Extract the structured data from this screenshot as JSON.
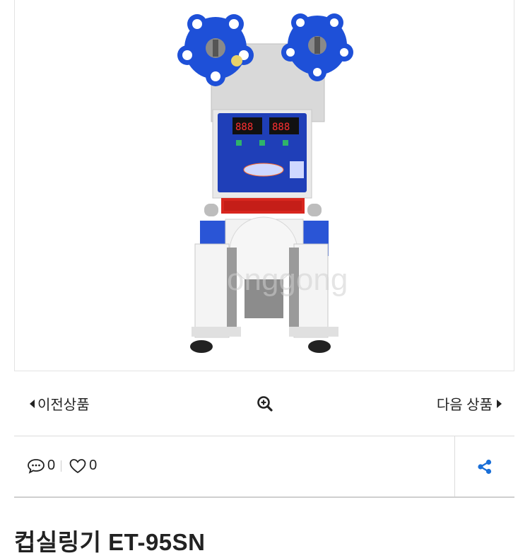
{
  "product_image": {
    "alt": "컵실링기 ET-95SN",
    "watermark": "onggong"
  },
  "navigation": {
    "prev_label": "이전상품",
    "next_label": "다음 상품"
  },
  "social": {
    "comment_count": "0",
    "like_count": "0"
  },
  "product": {
    "title": "컵실링기 ET-95SN"
  },
  "colors": {
    "accent": "#1a6fd8",
    "machine_blue": "#1f4fd0"
  }
}
